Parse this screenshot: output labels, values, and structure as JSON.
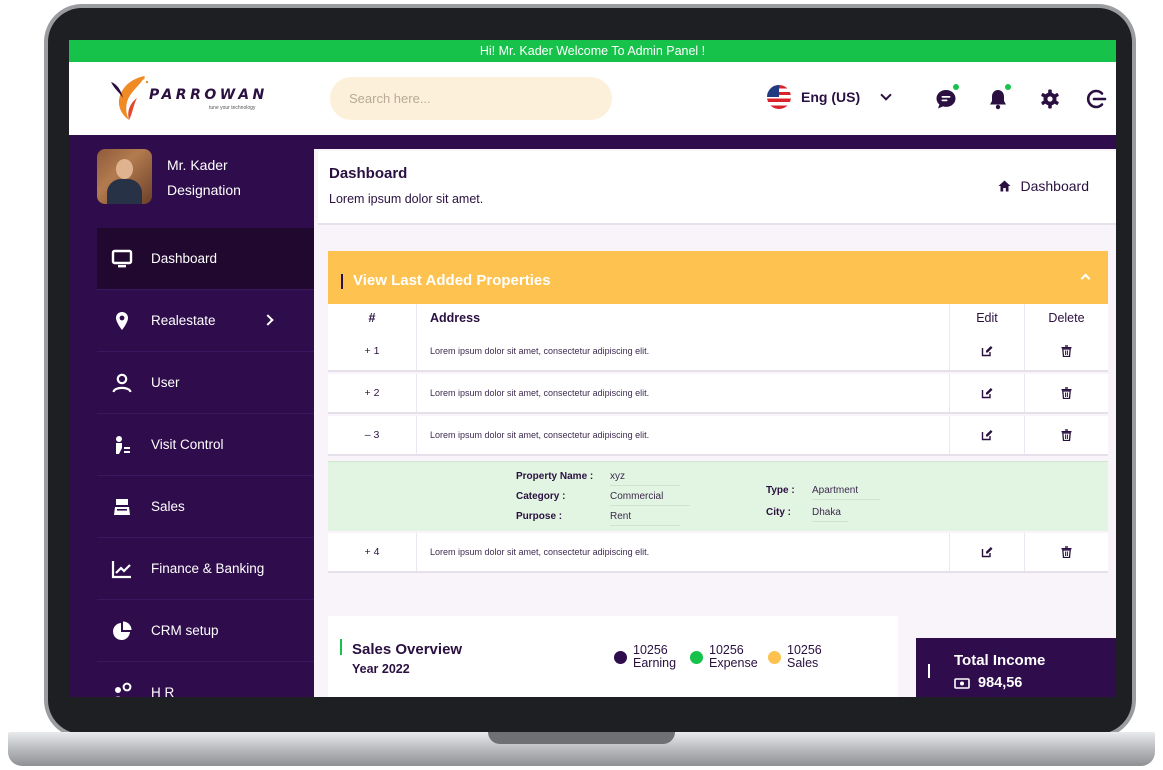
{
  "welcome": "Hi! Mr. Kader Welcome To Admin Panel !",
  "brand": {
    "name": "PARROWAN",
    "tagline": "tune your technology"
  },
  "search": {
    "placeholder": "Search here..."
  },
  "language": {
    "label": "Eng (US)"
  },
  "user": {
    "name": "Mr. Kader",
    "designation": "Designation"
  },
  "sidebar": {
    "items": [
      {
        "label": "Dashboard",
        "icon": "monitor-icon"
      },
      {
        "label": "Realestate",
        "icon": "location-pin-icon"
      },
      {
        "label": "User",
        "icon": "user-icon"
      },
      {
        "label": "Visit Control",
        "icon": "visit-control-icon"
      },
      {
        "label": "Sales",
        "icon": "sales-icon"
      },
      {
        "label": "Finance & Banking",
        "icon": "chart-line-icon"
      },
      {
        "label": "CRM setup",
        "icon": "pie-chart-icon"
      },
      {
        "label": "H R",
        "icon": "hr-users-icon"
      }
    ]
  },
  "page": {
    "title": "Dashboard",
    "subtitle": "Lorem ipsum dolor sit amet.",
    "breadcrumb": "Dashboard"
  },
  "properties": {
    "title": "View Last Added Properties",
    "columns": {
      "num": "#",
      "address": "Address",
      "edit": "Edit",
      "delete": "Delete"
    },
    "rows": [
      {
        "num": "+ 1",
        "address": "Lorem ipsum dolor sit amet, consectetur adipiscing elit."
      },
      {
        "num": "+ 2",
        "address": "Lorem ipsum dolor sit amet, consectetur adipiscing elit."
      },
      {
        "num": "– 3",
        "address": "Lorem ipsum dolor sit amet, consectetur adipiscing elit."
      },
      {
        "num": "+ 4",
        "address": "Lorem ipsum dolor sit amet, consectetur adipiscing elit."
      }
    ],
    "detail": {
      "property_name_label": "Property Name :",
      "property_name": "xyz",
      "category_label": "Category :",
      "category": "Commercial",
      "purpose_label": "Purpose :",
      "purpose": "Rent",
      "type_label": "Type :",
      "type": "Apartment",
      "city_label": "City :",
      "city": "Dhaka"
    }
  },
  "sales_overview": {
    "title": "Sales Overview",
    "year": "Year 2022",
    "legend": [
      {
        "value": "10256",
        "label": "Earning",
        "color": "#2f0d4c"
      },
      {
        "value": "10256",
        "label": "Expense",
        "color": "#17c24b"
      },
      {
        "value": "10256",
        "label": "Sales",
        "color": "#fdc24f"
      }
    ]
  },
  "total_income": {
    "title": "Total Income",
    "value": "984,56"
  },
  "colors": {
    "accent_green": "#17c24b",
    "sidebar_purple": "#2f0d4c",
    "card_yellow": "#fdc24f",
    "detail_green": "#e2f4e2"
  }
}
